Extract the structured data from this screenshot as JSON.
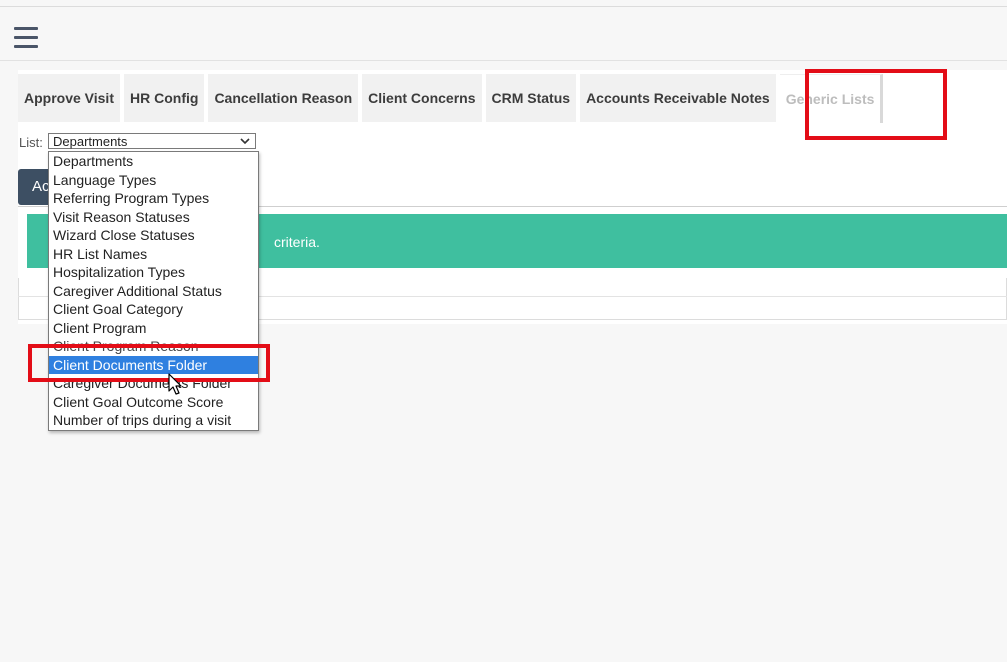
{
  "header": {
    "menu_icon": "hamburger-menu-icon"
  },
  "tabs": [
    {
      "label": "Approve Visit",
      "active": false
    },
    {
      "label": "HR Config",
      "active": false
    },
    {
      "label": "Cancellation Reason",
      "active": false
    },
    {
      "label": "Client Concerns",
      "active": false
    },
    {
      "label": "CRM Status",
      "active": false
    },
    {
      "label": "Accounts Receivable Notes",
      "active": false
    },
    {
      "label": "Generic Lists",
      "active": true
    }
  ],
  "list_filter": {
    "label": "List:",
    "selected_value": "Departments",
    "options": [
      "Departments",
      "Language Types",
      "Referring Program Types",
      "Visit Reason Statuses",
      "Wizard Close Statuses",
      "HR List Names",
      "Hospitalization Types",
      "Caregiver Additional Status",
      "Client Goal Category",
      "Client Program",
      "Client Program Reason",
      "Client Documents Folder",
      "Caregiver Documents Folder",
      "Client Goal Outcome Score",
      "Number of trips during a visit"
    ],
    "highlighted_option": "Client Documents Folder"
  },
  "add_button": {
    "label": "Ac"
  },
  "alert": {
    "text": "criteria."
  },
  "colors": {
    "alert_bg": "#3fbf9f",
    "highlight_red": "#e30d17",
    "selected_option_bg": "#2f80e0",
    "button_bg": "#3d4f63"
  }
}
